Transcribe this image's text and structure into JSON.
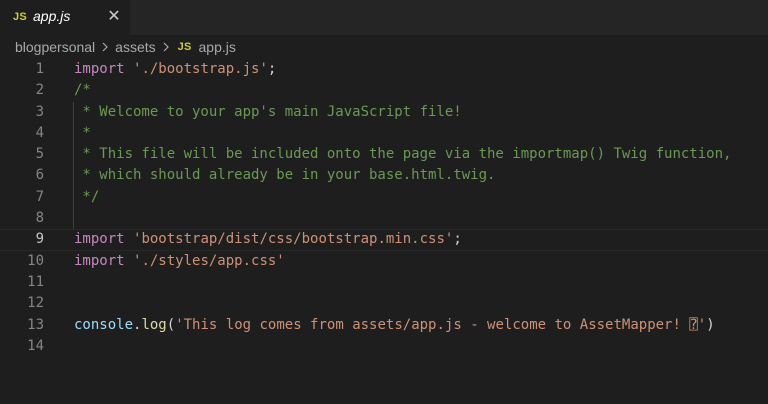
{
  "tab": {
    "icon_label": "JS",
    "title": "app.js",
    "close_glyph": "✕",
    "icon": "close-icon"
  },
  "breadcrumb": {
    "items": [
      "blogpersonal",
      "assets",
      "app.js"
    ],
    "file_icon_label": "JS",
    "separator_icon": "chevron-right-icon"
  },
  "editor": {
    "current_line": 9,
    "lines": [
      {
        "number": "1",
        "tokens": [
          {
            "t": "import",
            "c": "kw"
          },
          {
            "t": " ",
            "c": "pl"
          },
          {
            "t": "'./bootstrap.js'",
            "c": "str"
          },
          {
            "t": ";",
            "c": "pl"
          }
        ]
      },
      {
        "number": "2",
        "tokens": [
          {
            "t": "/*",
            "c": "cm"
          }
        ]
      },
      {
        "number": "3",
        "tokens": [
          {
            "t": " * Welcome to your app's main JavaScript file!",
            "c": "cm"
          }
        ]
      },
      {
        "number": "4",
        "tokens": [
          {
            "t": " *",
            "c": "cm"
          }
        ]
      },
      {
        "number": "5",
        "tokens": [
          {
            "t": " * This file will be included onto the page via the importmap() Twig function,",
            "c": "cm"
          }
        ]
      },
      {
        "number": "6",
        "tokens": [
          {
            "t": " * which should already be in your base.html.twig.",
            "c": "cm"
          }
        ]
      },
      {
        "number": "7",
        "tokens": [
          {
            "t": " */",
            "c": "cm"
          }
        ]
      },
      {
        "number": "8",
        "tokens": []
      },
      {
        "number": "9",
        "tokens": [
          {
            "t": "import",
            "c": "kw"
          },
          {
            "t": " ",
            "c": "pl"
          },
          {
            "t": "'bootstrap/dist/css/bootstrap.min.css'",
            "c": "str"
          },
          {
            "t": ";",
            "c": "pl"
          }
        ]
      },
      {
        "number": "10",
        "tokens": [
          {
            "t": "import",
            "c": "kw"
          },
          {
            "t": " ",
            "c": "pl"
          },
          {
            "t": "'./styles/app.css'",
            "c": "str"
          }
        ]
      },
      {
        "number": "11",
        "tokens": []
      },
      {
        "number": "12",
        "tokens": []
      },
      {
        "number": "13",
        "tokens": [
          {
            "t": "console",
            "c": "var"
          },
          {
            "t": ".",
            "c": "pl"
          },
          {
            "t": "log",
            "c": "fn"
          },
          {
            "t": "(",
            "c": "pl"
          },
          {
            "t": "'This log comes from assets/app.js - welcome to AssetMapper! ⍰'",
            "c": "str"
          },
          {
            "t": ")",
            "c": "pl"
          }
        ]
      },
      {
        "number": "14",
        "tokens": []
      }
    ]
  },
  "colors": {
    "background": "#1e1e1e",
    "tabbar": "#252526",
    "keyword": "#c586c0",
    "string": "#ce9178",
    "comment": "#6a9955",
    "js_icon": "#cbcb41"
  }
}
